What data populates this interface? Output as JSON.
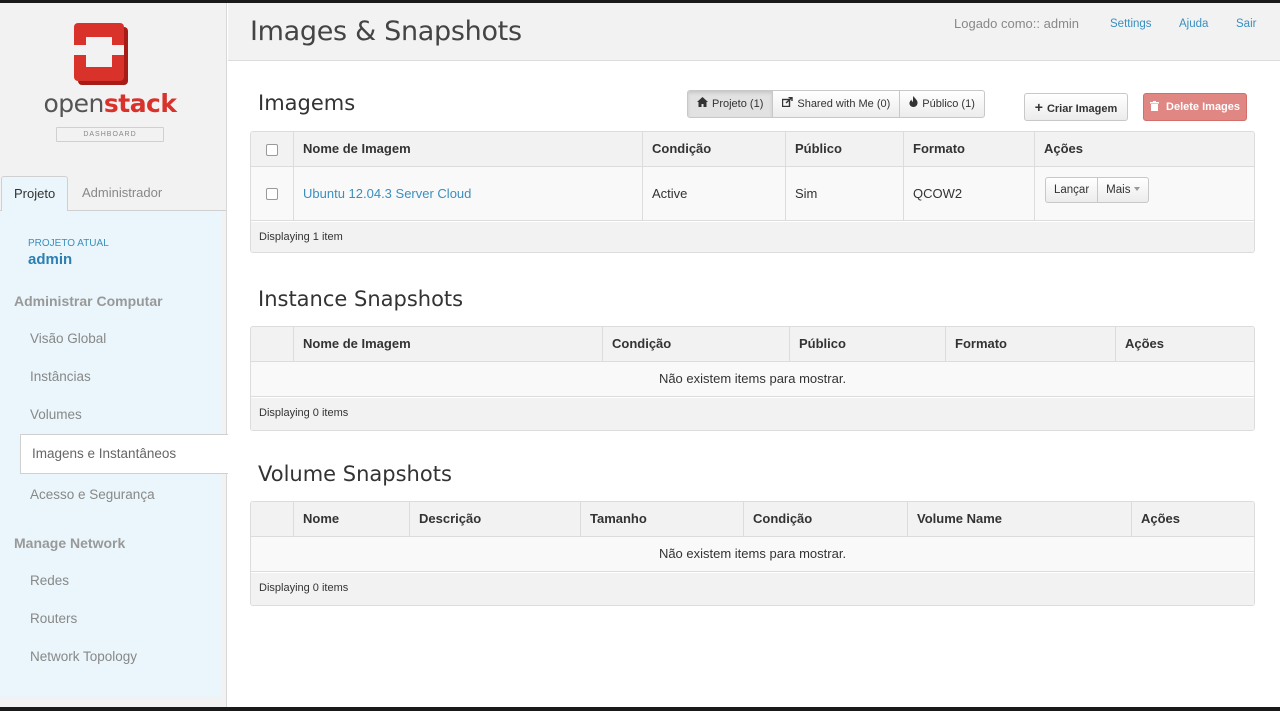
{
  "sidebar": {
    "logo_open": "open",
    "logo_stack": "stack",
    "logo_sub": "DASHBOARD",
    "tabs": [
      {
        "label": "Projeto",
        "active": true
      },
      {
        "label": "Administrador",
        "active": false
      }
    ],
    "project_label": "PROJETO ATUAL",
    "project_name": "admin",
    "sections": [
      {
        "title": "Administrar Computar",
        "items": [
          "Visão Global",
          "Instâncias",
          "Volumes",
          "Imagens e Instantâneos",
          "Acesso e Segurança"
        ]
      },
      {
        "title": "Manage Network",
        "items": [
          "Redes",
          "Routers",
          "Network Topology"
        ]
      }
    ],
    "active_item": "Imagens e Instantâneos"
  },
  "header": {
    "title": "Images & Snapshots",
    "logged_as": "Logado como:: admin",
    "links": [
      "Settings",
      "Ajuda",
      "Sair"
    ]
  },
  "images": {
    "title": "Imagems",
    "filters": [
      {
        "label": "Projeto (1)",
        "icon": "home-icon",
        "active": true
      },
      {
        "label": "Shared with Me (0)",
        "icon": "share-icon",
        "active": false
      },
      {
        "label": "Público (1)",
        "icon": "fire-icon",
        "active": false
      }
    ],
    "create_label": "Criar Imagem",
    "delete_label": "Delete Images",
    "columns": [
      "Nome de Imagem",
      "Condição",
      "Público",
      "Formato",
      "Ações"
    ],
    "rows": [
      {
        "name": "Ubuntu 12.04.3 Server Cloud",
        "status": "Active",
        "public": "Sim",
        "format": "QCOW2",
        "action_primary": "Lançar",
        "action_more": "Mais"
      }
    ],
    "footer": "Displaying 1 item"
  },
  "instance_snapshots": {
    "title": "Instance Snapshots",
    "columns": [
      "Nome de Imagem",
      "Condição",
      "Público",
      "Formato",
      "Ações"
    ],
    "empty": "Não existem items para mostrar.",
    "footer": "Displaying 0 items"
  },
  "volume_snapshots": {
    "title": "Volume Snapshots",
    "columns": [
      "Nome",
      "Descrição",
      "Tamanho",
      "Condição",
      "Volume Name",
      "Ações"
    ],
    "empty": "Não existem items para mostrar.",
    "footer": "Displaying 0 items"
  },
  "colors": {
    "accent": "#3a8fbf",
    "brand_red": "#d8322b",
    "danger": "#e08683"
  }
}
